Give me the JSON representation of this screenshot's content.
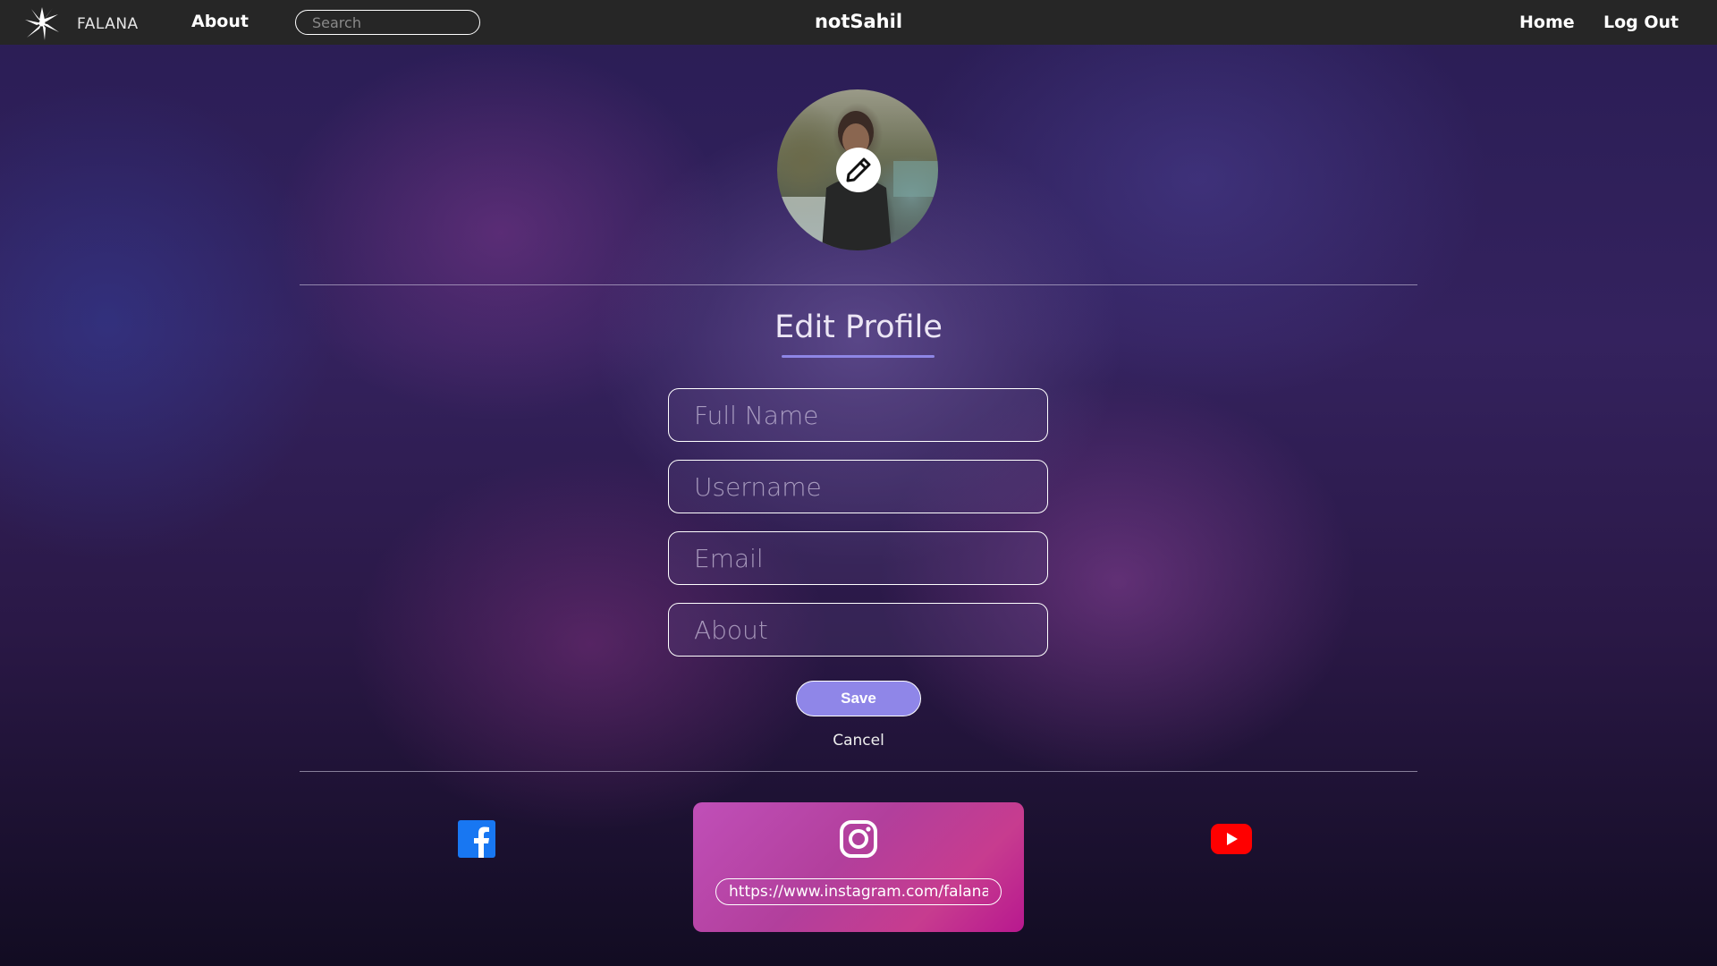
{
  "navbar": {
    "brand": "FALANA",
    "about_link": "About",
    "search_placeholder": "Search",
    "username": "notSahil",
    "home_link": "Home",
    "logout_link": "Log Out"
  },
  "profile": {
    "avatar_alt": "Profile photo",
    "edit_icon": "pencil-icon"
  },
  "form": {
    "heading": "Edit Profile",
    "full_name_placeholder": "Full Name",
    "username_placeholder": "Username",
    "email_placeholder": "Email",
    "about_placeholder": "About",
    "save_label": "Save",
    "cancel_label": "Cancel"
  },
  "social": {
    "facebook_icon": "facebook-icon",
    "instagram_icon": "instagram-icon",
    "instagram_url": "https://www.instagram.com/falana",
    "youtube_icon": "youtube-icon"
  },
  "colors": {
    "accent": "#8f86e8",
    "navbar": "#262626",
    "facebook": "#1877f2",
    "youtube": "#ff0000"
  }
}
